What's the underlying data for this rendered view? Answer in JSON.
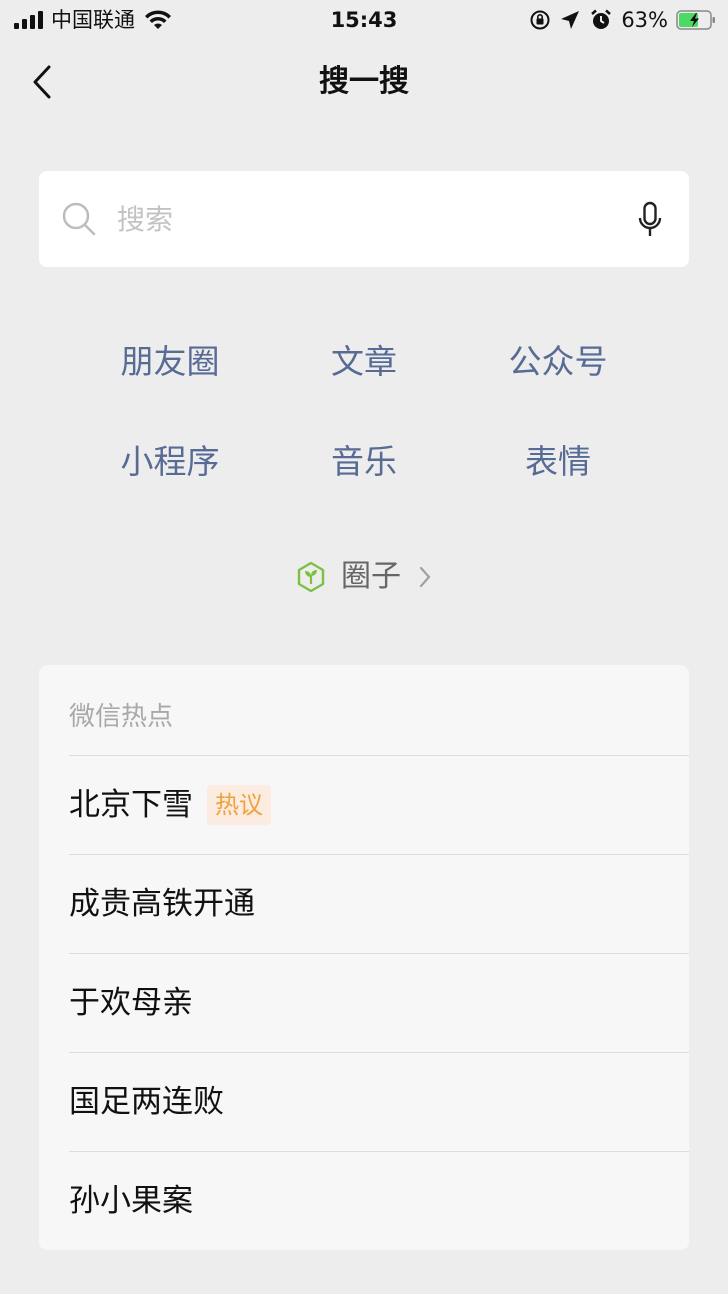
{
  "status_bar": {
    "carrier": "中国联通",
    "time": "15:43",
    "battery_percent": "63%"
  },
  "nav": {
    "title": "搜一搜"
  },
  "search": {
    "placeholder": "搜索"
  },
  "categories": [
    {
      "label": "朋友圈"
    },
    {
      "label": "文章"
    },
    {
      "label": "公众号"
    },
    {
      "label": "小程序"
    },
    {
      "label": "音乐"
    },
    {
      "label": "表情"
    }
  ],
  "circle": {
    "label": "圈子"
  },
  "hot": {
    "header": "微信热点",
    "items": [
      {
        "text": "北京下雪",
        "badge": "热议"
      },
      {
        "text": "成贵高铁开通"
      },
      {
        "text": "于欢母亲"
      },
      {
        "text": "国足两连败"
      },
      {
        "text": "孙小果案"
      }
    ]
  },
  "colors": {
    "link": "#576b95",
    "badge_text": "#f0a33a",
    "badge_bg": "#fbebe0",
    "circle_icon": "#7cc242",
    "battery_fill": "#4cd964"
  },
  "icons": {
    "back": "chevron-left-icon",
    "search": "search-icon",
    "mic": "microphone-icon",
    "circle": "cube-sprout-icon",
    "chevron": "chevron-right-icon"
  }
}
